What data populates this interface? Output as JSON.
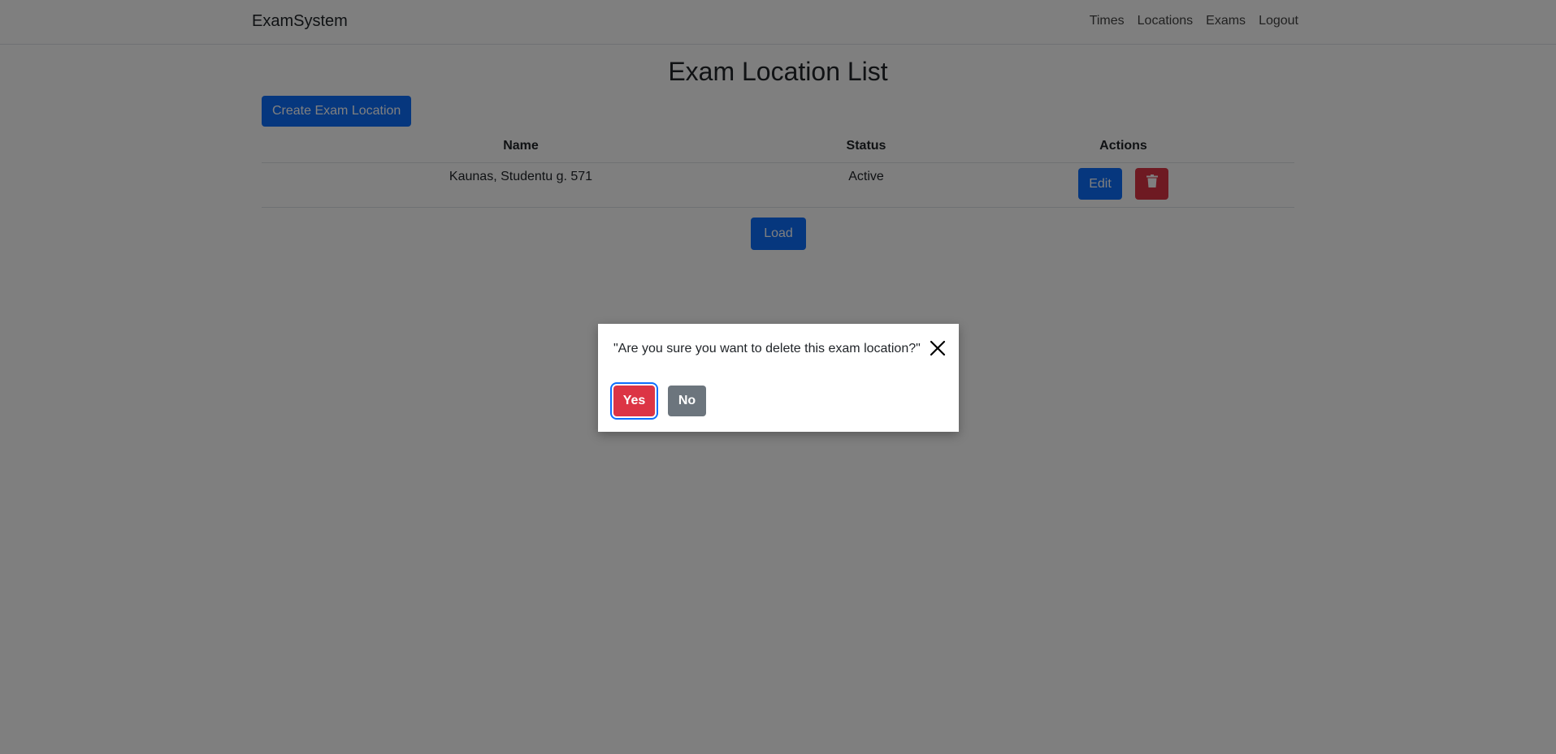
{
  "navbar": {
    "brand": "ExamSystem",
    "links": [
      "Times",
      "Locations",
      "Exams",
      "Logout"
    ]
  },
  "main": {
    "title": "Exam Location List",
    "create_button": "Create Exam Location",
    "table": {
      "headers": [
        "Name",
        "Status",
        "Actions"
      ],
      "rows": [
        {
          "name": "Kaunas, Studentu g. 571",
          "status": "Active",
          "edit_label": "Edit",
          "delete_icon": "trash-icon"
        }
      ]
    },
    "load_button": "Load"
  },
  "modal": {
    "message": "\"Are you sure you want to delete this exam location?\"",
    "close_icon": "close-icon",
    "yes_label": "Yes",
    "no_label": "No"
  },
  "colors": {
    "primary": "#0d6efd",
    "danger": "#dc3545",
    "secondary": "#6c757d",
    "overlay": "rgba(0,0,0,0.5)"
  }
}
